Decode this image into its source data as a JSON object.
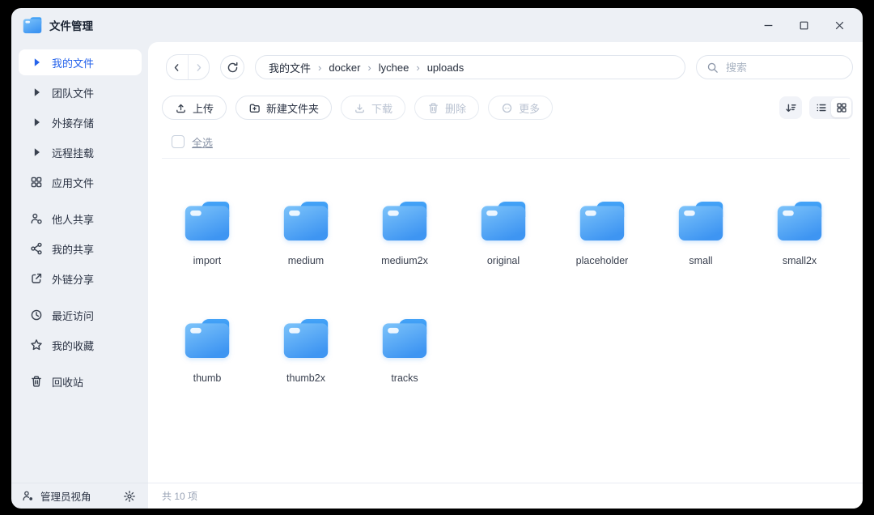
{
  "colors": {
    "accent": "#2563eb",
    "window_bg": "#edf0f5",
    "panel_bg": "#ffffff",
    "folder_gradient_light": "#7cc3fa",
    "folder_gradient_dark": "#3e95f2",
    "folder_back": "#2f93f4",
    "disabled_text": "#b9c2d1"
  },
  "titlebar": {
    "title": "文件管理",
    "app_icon": "folder-blue",
    "controls": [
      {
        "name": "minimize-button",
        "icon": "minimize"
      },
      {
        "name": "maximize-button",
        "icon": "maximize"
      },
      {
        "name": "close-button",
        "icon": "close"
      }
    ]
  },
  "sidebar": {
    "items": [
      {
        "name": "sidebar-item-my-files",
        "label": "我的文件",
        "icon": "caret-right",
        "selected": true,
        "gap": false
      },
      {
        "name": "sidebar-item-team-files",
        "label": "团队文件",
        "icon": "caret-right",
        "selected": false,
        "gap": false
      },
      {
        "name": "sidebar-item-external-storage",
        "label": "外接存储",
        "icon": "caret-right",
        "selected": false,
        "gap": false
      },
      {
        "name": "sidebar-item-remote-mount",
        "label": "远程挂载",
        "icon": "caret-right",
        "selected": false,
        "gap": false
      },
      {
        "name": "sidebar-item-app-files",
        "label": "应用文件",
        "icon": "apps",
        "selected": false,
        "gap": false
      },
      {
        "name": "sidebar-item-shared-by-others",
        "label": "他人共享",
        "icon": "person-share",
        "selected": false,
        "gap": true
      },
      {
        "name": "sidebar-item-my-shares",
        "label": "我的共享",
        "icon": "share-nodes",
        "selected": false,
        "gap": false
      },
      {
        "name": "sidebar-item-external-links",
        "label": "外链分享",
        "icon": "export-box",
        "selected": false,
        "gap": false
      },
      {
        "name": "sidebar-item-recent",
        "label": "最近访问",
        "icon": "clock",
        "selected": false,
        "gap": true
      },
      {
        "name": "sidebar-item-favorites",
        "label": "我的收藏",
        "icon": "star",
        "selected": false,
        "gap": false
      },
      {
        "name": "sidebar-item-recycle-bin",
        "label": "回收站",
        "icon": "trash",
        "selected": false,
        "gap": true
      }
    ],
    "footer": {
      "label": "管理员视角",
      "person_icon": "admin-person",
      "settings_icon": "gear"
    }
  },
  "nav": {
    "breadcrumb": [
      "我的文件",
      "docker",
      "lychee",
      "uploads"
    ],
    "breadcrumb_separator": "›",
    "search_placeholder": "搜索"
  },
  "toolbar": {
    "buttons": [
      {
        "name": "upload-button",
        "label": "上传",
        "icon": "upload",
        "enabled": true
      },
      {
        "name": "new-folder-button",
        "label": "新建文件夹",
        "icon": "folder-plus",
        "enabled": true
      },
      {
        "name": "download-button",
        "label": "下载",
        "icon": "download",
        "enabled": false
      },
      {
        "name": "delete-button",
        "label": "删除",
        "icon": "trash",
        "enabled": false
      },
      {
        "name": "more-button",
        "label": "更多",
        "icon": "circle-more",
        "enabled": false
      }
    ],
    "view": {
      "sort_icon": "sort-desc",
      "list_icon": "list-view",
      "grid_icon": "grid-view",
      "active_view": "grid"
    }
  },
  "content": {
    "select_all_label": "全选",
    "folders": [
      "import",
      "medium",
      "medium2x",
      "original",
      "placeholder",
      "small",
      "small2x",
      "thumb",
      "thumb2x",
      "tracks"
    ]
  },
  "statusbar": {
    "total": "共 10 项"
  }
}
